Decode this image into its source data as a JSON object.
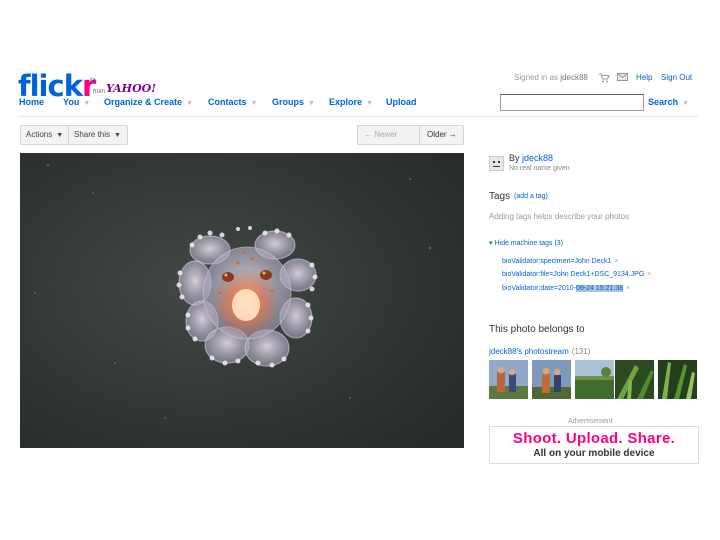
{
  "header": {
    "logo_part1": "flick",
    "logo_part2": "r",
    "logo_trademark": "®",
    "logo_from": "from",
    "logo_yahoo": "YAHOO!",
    "signed_in_prefix": "Signed in as",
    "signed_in_user": "jdeck88",
    "help": "Help",
    "sign_out": "Sign Out",
    "search_button": "Search",
    "search_value": ""
  },
  "nav": {
    "items": [
      {
        "label": "Home"
      },
      {
        "label": "You"
      },
      {
        "label": "Organize & Create"
      },
      {
        "label": "Contacts"
      },
      {
        "label": "Groups"
      },
      {
        "label": "Explore"
      },
      {
        "label": "Upload"
      }
    ]
  },
  "toolbar": {
    "actions": "Actions",
    "share": "Share this",
    "newer": "← Newer",
    "older": "Older →"
  },
  "photo": {
    "alt": "octopus larva"
  },
  "owner": {
    "by_prefix": "By",
    "name": "jdeck88",
    "realname": "No real name given"
  },
  "tags": {
    "heading": "Tags",
    "add_link": "(add a tag)",
    "hint": "Adding tags helps describe your photos",
    "hide_machine": "▾ Hide machine tags (3)",
    "machine_tags": [
      {
        "text": "bioValidator:specimen=John Deck1"
      },
      {
        "text": "bioValidator:file=John Deck1+DSC_9134.JPG"
      },
      {
        "text_pre": "bioValidator:date=2010-",
        "text_hl": "09-24 15:21:38"
      }
    ],
    "remove_glyph": "×"
  },
  "belongs": {
    "heading": "This photo belongs to",
    "stream": "jdeck88's photostream",
    "count": "(131)"
  },
  "ad": {
    "label": "Advertisement",
    "line1": "Shoot. Upload. Share.",
    "line2": "All on your mobile device"
  },
  "colors": {
    "brand_blue": "#0063dc",
    "brand_pink": "#ff0084",
    "yahoo_purple": "#7b0099"
  },
  "icons": {
    "cart": "cart-icon",
    "mail": "mail-icon",
    "buddy": "buddy-icon"
  }
}
